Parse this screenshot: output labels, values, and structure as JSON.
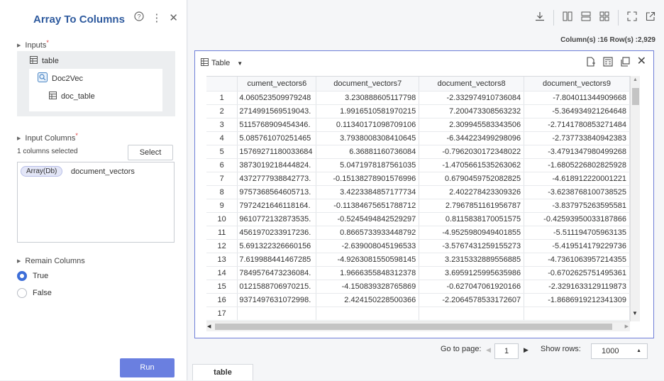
{
  "panel": {
    "title": "Array To Columns",
    "inputs_label": "Inputs",
    "tree": {
      "root": "table",
      "child": "Doc2Vec",
      "grandchild": "doc_table"
    },
    "input_columns_label": "Input Columns",
    "columns_selected": "1 columns selected",
    "select_label": "Select",
    "selected_column_type": "Array(Db)",
    "selected_column_name": "document_vectors",
    "remain_columns_label": "Remain Columns",
    "true_label": "True",
    "false_label": "False",
    "remain_value": "True",
    "run_label": "Run",
    "icons": [
      "help-circle-icon",
      "more-vertical-icon",
      "close-icon"
    ]
  },
  "toolbar": {
    "summary": "Column(s) :16  Row(s) :2,929",
    "icons": [
      "download-icon",
      "columns-layout-icon",
      "rows-layout-icon",
      "grid-layout-icon",
      "fullscreen-icon",
      "external-link-icon"
    ]
  },
  "table_panel": {
    "view_label": "Table",
    "icons": [
      "export-file-icon",
      "calculator-icon",
      "copy-icon",
      "close-icon"
    ],
    "columns": [
      "cument_vectors6",
      "document_vectors7",
      "document_vectors8",
      "document_vectors9"
    ],
    "rows": [
      [
        "1",
        "4.060523509979248",
        "3.230888605117798",
        "-2.332974910736084",
        "-7.804011344909668"
      ],
      [
        "2",
        ".2714991569519043",
        "1.9916510581970215",
        "7.200473308563232",
        "-5.364934921264648"
      ],
      [
        "3",
        ".5115768909454346",
        "0.11340171098709106",
        "2.309945583343506",
        "-2.7141780853271484"
      ],
      [
        "4",
        "5.085761070251465",
        "3.7938008308410645",
        "-6.344223499298096",
        "-2.737733840942383"
      ],
      [
        "5",
        "15769271180033684",
        "6.36881160736084",
        "-0.7962030172348022",
        "-3.4791347980499268"
      ],
      [
        "6",
        ".3873019218444824",
        "5.0471978187561035",
        "-1.4705661535263062",
        "-1.6805226802825928"
      ],
      [
        "7",
        ".4372777938842773",
        "-0.15138278901576996",
        "0.6790459752082825",
        "-4.618912220001221"
      ],
      [
        "8",
        ".9757368564605713",
        "3.4223384857177734",
        "2.402278423309326",
        "-3.6238768100738525"
      ],
      [
        "9",
        ".7972421646118164",
        "-0.11384675651788712",
        "2.7967851161956787",
        "-3.837975263595581"
      ],
      [
        "10",
        ".9610772132873535",
        "-0.5245494842529297",
        "0.8115838170051575",
        "-0.42593950033187866"
      ],
      [
        "11",
        ".4561970233917236",
        "0.8665733933448792",
        "-4.9525980949401855",
        "-5.511194705963135"
      ],
      [
        "12",
        "5.691322326660156",
        "-2.639008045196533",
        "-3.5767431259155273",
        "-5.419514179229736"
      ],
      [
        "13",
        "7.619988441467285",
        "-4.9263081550598145",
        "3.2315332889556885",
        "-4.7361063957214355"
      ],
      [
        "14",
        ".7849576473236084",
        "1.9666355848312378",
        "3.6959125995635986",
        "-0.6702625751495361"
      ],
      [
        "15",
        ".0121588706970215",
        "-4.150839328765869",
        "-0.627047061920166",
        "-2.3291633129119873"
      ],
      [
        "16",
        ".9371497631072998",
        "2.424150228500366",
        "-2.2064578533172607",
        "-1.8686919212341309"
      ],
      [
        "17",
        "",
        "",
        "",
        ""
      ]
    ]
  },
  "pager": {
    "goto_label": "Go to page:",
    "page": "1",
    "show_rows_label": "Show rows:",
    "rows_value": "1000"
  },
  "bottom_tab": "table"
}
